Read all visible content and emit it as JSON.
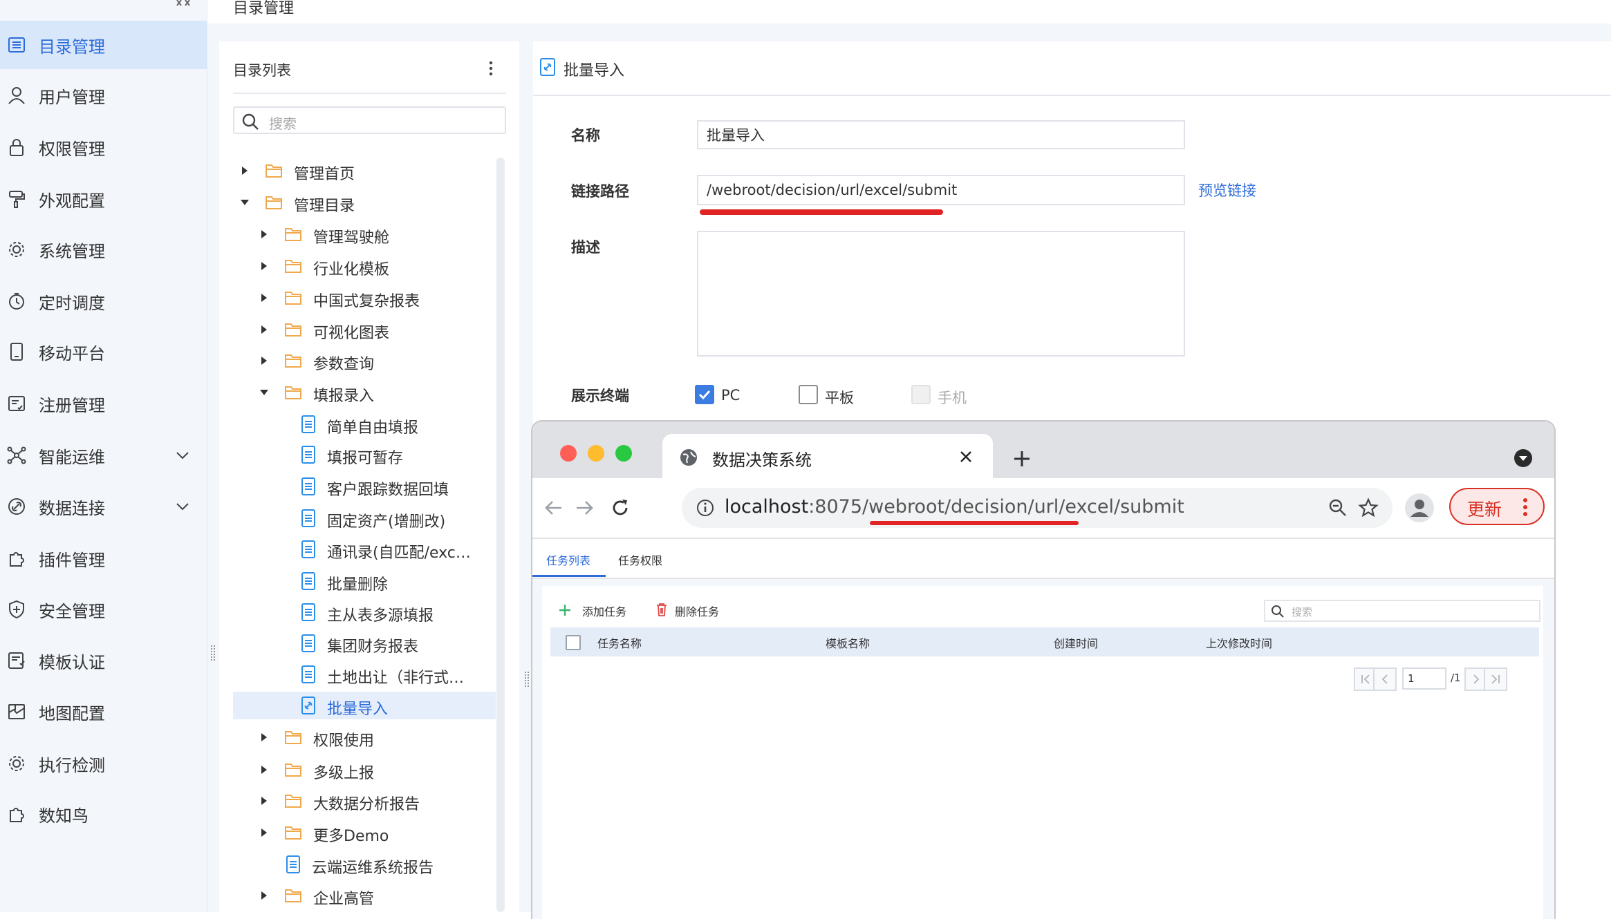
{
  "header": {
    "title": "目录管理"
  },
  "sidebar": {
    "items": [
      {
        "label": "目录管理",
        "icon": "list-icon",
        "active": true
      },
      {
        "label": "用户管理",
        "icon": "user-icon"
      },
      {
        "label": "权限管理",
        "icon": "lock-icon"
      },
      {
        "label": "外观配置",
        "icon": "paint-roller-icon"
      },
      {
        "label": "系统管理",
        "icon": "gear-icon"
      },
      {
        "label": "定时调度",
        "icon": "timer-icon"
      },
      {
        "label": "移动平台",
        "icon": "mobile-icon"
      },
      {
        "label": "注册管理",
        "icon": "register-icon"
      },
      {
        "label": "智能运维",
        "icon": "network-icon",
        "expandable": true
      },
      {
        "label": "数据连接",
        "icon": "link-icon",
        "expandable": true
      },
      {
        "label": "插件管理",
        "icon": "puzzle-icon"
      },
      {
        "label": "安全管理",
        "icon": "shield-icon"
      },
      {
        "label": "模板认证",
        "icon": "certificate-icon"
      },
      {
        "label": "地图配置",
        "icon": "map-icon"
      },
      {
        "label": "执行检测",
        "icon": "gear-check-icon"
      },
      {
        "label": "数知鸟",
        "icon": "puzzle-icon"
      }
    ]
  },
  "tree": {
    "title": "目录列表",
    "search_placeholder": "搜索",
    "items": [
      {
        "label": "管理首页",
        "type": "folder",
        "level": 0,
        "expanded": false
      },
      {
        "label": "管理目录",
        "type": "folder",
        "level": 0,
        "expanded": true
      },
      {
        "label": "管理驾驶舱",
        "type": "folder",
        "level": 1,
        "expanded": false
      },
      {
        "label": "行业化模板",
        "type": "folder",
        "level": 1,
        "expanded": false
      },
      {
        "label": "中国式复杂报表",
        "type": "folder",
        "level": 1,
        "expanded": false
      },
      {
        "label": "可视化图表",
        "type": "folder",
        "level": 1,
        "expanded": false
      },
      {
        "label": "参数查询",
        "type": "folder",
        "level": 1,
        "expanded": false
      },
      {
        "label": "填报录入",
        "type": "folder",
        "level": 1,
        "expanded": true
      },
      {
        "label": "简单自由填报",
        "type": "file",
        "level": 2
      },
      {
        "label": "填报可暂存",
        "type": "file",
        "level": 2
      },
      {
        "label": "客户跟踪数据回填",
        "type": "file",
        "level": 2
      },
      {
        "label": "固定资产(增删改)",
        "type": "file",
        "level": 2
      },
      {
        "label": "通讯录(自匹配/exc…",
        "type": "file",
        "level": 2
      },
      {
        "label": "批量删除",
        "type": "file",
        "level": 2
      },
      {
        "label": "主从表多源填报",
        "type": "file",
        "level": 2
      },
      {
        "label": "集团财务报表",
        "type": "file",
        "level": 2
      },
      {
        "label": "土地出让（非行式…",
        "type": "file",
        "level": 2
      },
      {
        "label": "批量导入",
        "type": "link",
        "level": 2,
        "selected": true
      },
      {
        "label": "权限使用",
        "type": "folder",
        "level": 1,
        "expanded": false
      },
      {
        "label": "多级上报",
        "type": "folder",
        "level": 1,
        "expanded": false
      },
      {
        "label": "大数据分析报告",
        "type": "folder",
        "level": 1,
        "expanded": false
      },
      {
        "label": "更多Demo",
        "type": "folder",
        "level": 1,
        "expanded": false
      },
      {
        "label": "云端运维系统报告",
        "type": "file",
        "level": 1
      },
      {
        "label": "企业高管",
        "type": "folder",
        "level": 1,
        "expanded": false
      }
    ]
  },
  "form": {
    "title": "批量导入",
    "name_label": "名称",
    "name_value": "批量导入",
    "path_label": "链接路径",
    "path_value": "/webroot/decision/url/excel/submit",
    "preview_link": "预览链接",
    "desc_label": "描述",
    "desc_value": "",
    "terminal_label": "展示终端",
    "terminals": [
      {
        "label": "PC",
        "checked": true,
        "disabled": false
      },
      {
        "label": "平板",
        "checked": false,
        "disabled": false
      },
      {
        "label": "手机",
        "checked": false,
        "disabled": true
      }
    ]
  },
  "browser": {
    "tab_title": "数据决策系统",
    "url_host": "localhost",
    "url_rest": ":8075/webroot/decision/url/excel/submit",
    "update_label": "更新",
    "app": {
      "tabs": [
        "任务列表",
        "任务权限"
      ],
      "add_task": "添加任务",
      "delete_task": "删除任务",
      "search_placeholder": "搜索",
      "columns": [
        "任务名称",
        "模板名称",
        "创建时间",
        "上次修改时间"
      ],
      "page_input": "1",
      "page_total": "/1"
    }
  },
  "colors": {
    "accent": "#2c6bd9",
    "folder": "#f0a94a",
    "annotation": "#e02424"
  }
}
